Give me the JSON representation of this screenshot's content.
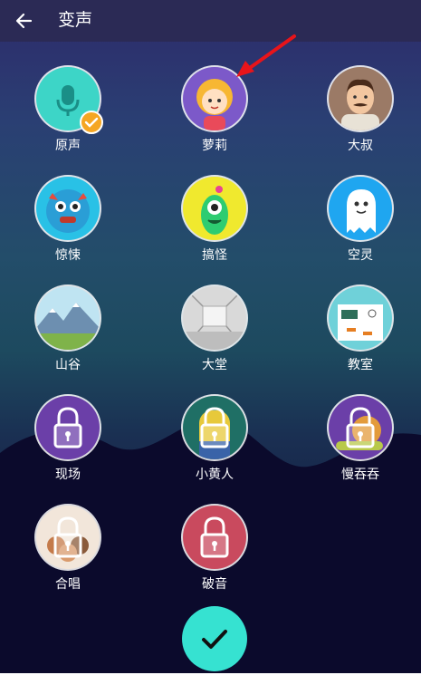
{
  "header": {
    "title": "变声"
  },
  "voices": [
    {
      "label": "原声",
      "icon": "microphone-icon",
      "selected": true,
      "locked": false
    },
    {
      "label": "萝莉",
      "icon": "girl-avatar-icon",
      "selected": false,
      "locked": false
    },
    {
      "label": "大叔",
      "icon": "man-avatar-icon",
      "selected": false,
      "locked": false
    },
    {
      "label": "惊悚",
      "icon": "monster-icon",
      "selected": false,
      "locked": false
    },
    {
      "label": "搞怪",
      "icon": "alien-icon",
      "selected": false,
      "locked": false
    },
    {
      "label": "空灵",
      "icon": "ghost-icon",
      "selected": false,
      "locked": false
    },
    {
      "label": "山谷",
      "icon": "mountain-icon",
      "selected": false,
      "locked": false
    },
    {
      "label": "大堂",
      "icon": "hall-icon",
      "selected": false,
      "locked": false
    },
    {
      "label": "教室",
      "icon": "classroom-icon",
      "selected": false,
      "locked": false
    },
    {
      "label": "现场",
      "icon": "lock-icon",
      "selected": false,
      "locked": true
    },
    {
      "label": "小黄人",
      "icon": "lock-icon",
      "selected": false,
      "locked": true
    },
    {
      "label": "慢吞吞",
      "icon": "lock-icon",
      "selected": false,
      "locked": true
    },
    {
      "label": "合唱",
      "icon": "lock-icon",
      "selected": false,
      "locked": true
    },
    {
      "label": "破音",
      "icon": "lock-icon",
      "selected": false,
      "locked": true
    }
  ],
  "colors": {
    "accent": "#36e2d1",
    "badge": "#f5a623",
    "annotation_arrow": "#e8141a"
  }
}
